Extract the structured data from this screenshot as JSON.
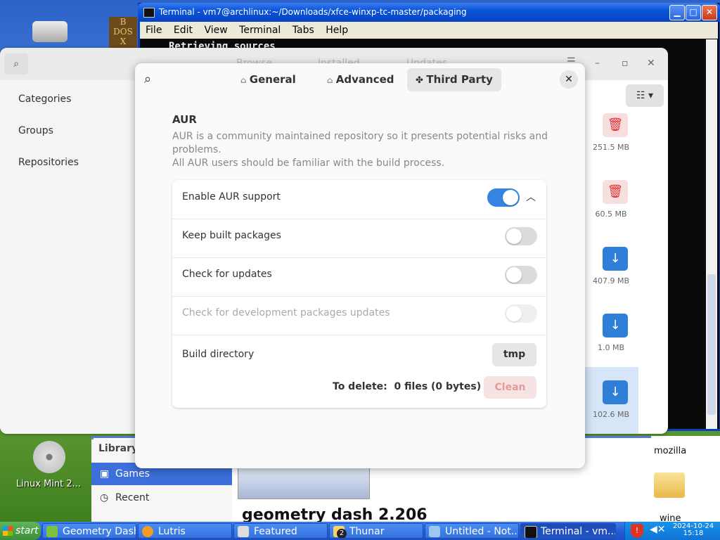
{
  "desktop": {
    "icons": [
      {
        "label": ""
      },
      {
        "label": "Linux Mint 2..."
      },
      {
        "label": "mozilla"
      },
      {
        "label": "wine"
      }
    ]
  },
  "terminal": {
    "title": "Terminal - vm7@archlinux:~/Downloads/xfce-winxp-tc-master/packaging",
    "menu": [
      "File",
      "Edit",
      "View",
      "Terminal",
      "Tabs",
      "Help"
    ],
    "text": "Retrieving sources"
  },
  "pamac": {
    "tabs": [
      "Browse",
      "Installed",
      "Updates"
    ],
    "sidebar": [
      "Categories",
      "Groups",
      "Repositories"
    ],
    "sizes": [
      "251.5 MB",
      "60.5 MB",
      "407.9 MB",
      "1.0 MB",
      "102.6 MB"
    ]
  },
  "dialog": {
    "tabs": [
      "General",
      "Advanced",
      "Third Party"
    ],
    "heading": "AUR",
    "desc_line1": "AUR is a community maintained repository so it presents potential risks and",
    "desc_line2": "problems.",
    "desc_line3": "All AUR users should be familiar with the build process.",
    "rows": {
      "enable_aur": "Enable AUR support",
      "keep_built": "Keep built packages",
      "check_updates": "Check for updates",
      "check_dev": "Check for development packages updates",
      "build_dir": "Build directory"
    },
    "build_dir_value": "tmp",
    "to_delete_label": "To delete:",
    "to_delete_value": "0 files  (0 bytes)",
    "clean_label": "Clean",
    "toggles": {
      "enable_aur": true,
      "keep_built": false,
      "check_updates": false,
      "check_dev": false
    }
  },
  "library": {
    "header": "Library",
    "items": [
      "Games",
      "Recent"
    ],
    "game_title": "geometry dash 2.206"
  },
  "taskbar": {
    "start": "start",
    "tasks": [
      "Geometry Dash",
      "Lutris",
      "Featured",
      "Thunar",
      "Untitled - Not...",
      "Terminal - vm..."
    ],
    "thunar_badge": "2",
    "date": "2024-10-24",
    "time": "15:18"
  }
}
